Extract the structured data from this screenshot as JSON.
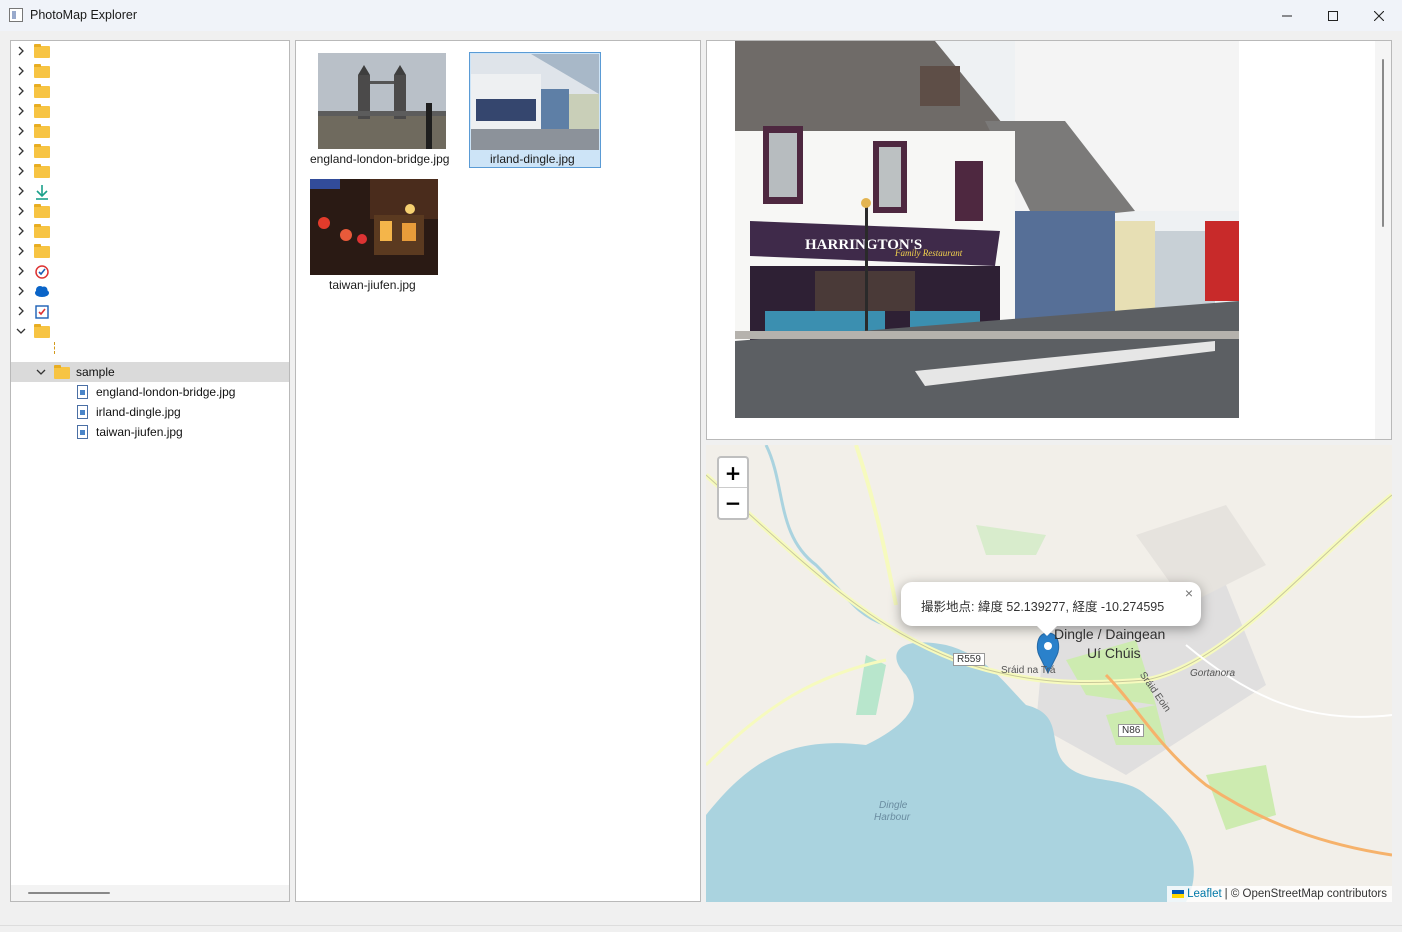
{
  "window": {
    "title": "PhotoMap Explorer",
    "controls": {
      "minimize": "—",
      "maximize": "☐",
      "close": "✕"
    }
  },
  "tree": {
    "roots": [
      {
        "icon": "folder-icon",
        "expanded": false
      },
      {
        "icon": "folder-icon",
        "expanded": false
      },
      {
        "icon": "folder-icon",
        "expanded": false
      },
      {
        "icon": "folder-icon",
        "expanded": false
      },
      {
        "icon": "folder-icon",
        "expanded": false
      },
      {
        "icon": "folder-icon",
        "expanded": false
      },
      {
        "icon": "folder-icon",
        "expanded": false
      },
      {
        "icon": "download-icon",
        "expanded": false
      },
      {
        "icon": "folder-icon",
        "expanded": false
      },
      {
        "icon": "folder-icon",
        "expanded": false
      },
      {
        "icon": "folder-icon",
        "expanded": false
      },
      {
        "icon": "checklist-icon",
        "expanded": false
      },
      {
        "icon": "cloud-icon",
        "expanded": false
      },
      {
        "icon": "calendar-icon",
        "expanded": false
      },
      {
        "icon": "folder-icon",
        "expanded": true
      }
    ],
    "folder": {
      "label": "sample",
      "expanded": true
    },
    "files": [
      "england-london-bridge.jpg",
      "irland-dingle.jpg",
      "taiwan-jiufen.jpg"
    ]
  },
  "thumbnails": [
    {
      "label": "england-london-bridge.jpg",
      "selected": false
    },
    {
      "label": "irland-dingle.jpg",
      "selected": true
    },
    {
      "label": "taiwan-jiufen.jpg",
      "selected": false
    }
  ],
  "map": {
    "zoom_in": "+",
    "zoom_out": "−",
    "popup_text": "撮影地点: 緯度 52.139277, 経度 -10.274595",
    "popup_close": "×",
    "place_name_1": "Dingle / Daingean",
    "place_name_2": "Uí Chúis",
    "labels": {
      "r559": "R559",
      "n86": "N86",
      "straid_na_tra": "Sráid na Trá",
      "straid_eoin": "Sráid Eoin",
      "gortanora": "Gortanora",
      "harbour_1": "Dingle",
      "harbour_2": "Harbour"
    },
    "attribution_leaflet": "Leaflet",
    "attribution_rest": "| © OpenStreetMap contributors"
  },
  "colors": {
    "accent": "#0078d4",
    "folder": "#f7c443",
    "selection": "#cde4f7",
    "marker": "#2a81cb",
    "water": "#aad3df"
  }
}
